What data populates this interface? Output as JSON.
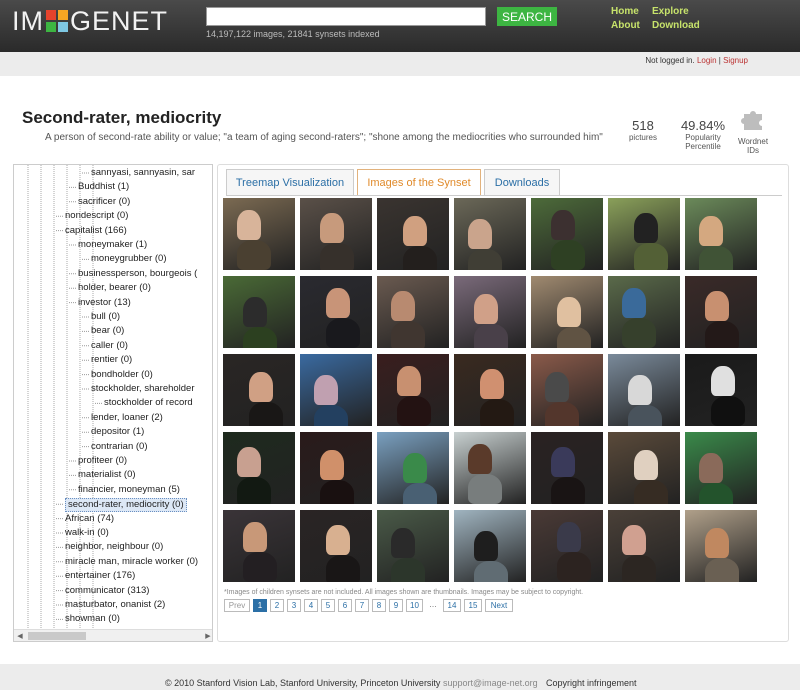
{
  "header": {
    "logo": {
      "left": "IM",
      "right": "GENET"
    },
    "search": {
      "value": "",
      "placeholder": ""
    },
    "search_button": "SEARCH",
    "stats": "14,197,122 images, 21841 synsets indexed",
    "nav": {
      "home": "Home",
      "explore": "Explore",
      "about": "About",
      "download": "Download"
    }
  },
  "login": {
    "status": "Not logged in.",
    "login": "Login",
    "sep": "|",
    "signup": "Signup"
  },
  "synset": {
    "title": "Second-rater, mediocrity",
    "gloss": "A person of second-rate ability or value; \"a team of aging second-raters\"; \"shone among the mediocrities who surrounded him\"",
    "pictures": {
      "value": "518",
      "label": "pictures"
    },
    "popularity": {
      "value": "49.84%",
      "label1": "Popularity",
      "label2": "Percentile"
    },
    "wordnet": {
      "label1": "Wordnet",
      "label2": "IDs"
    }
  },
  "tree": [
    {
      "label": "sannyasi, sannyasin, sar",
      "depth": 5
    },
    {
      "label": "Buddhist (1)",
      "depth": 4
    },
    {
      "label": "sacrificer (0)",
      "depth": 4
    },
    {
      "label": "nondescript (0)",
      "depth": 3
    },
    {
      "label": "capitalist (166)",
      "depth": 3
    },
    {
      "label": "moneymaker (1)",
      "depth": 4
    },
    {
      "label": "moneygrubber (0)",
      "depth": 5
    },
    {
      "label": "businessperson, bourgeois (",
      "depth": 4
    },
    {
      "label": "holder, bearer (0)",
      "depth": 4
    },
    {
      "label": "investor (13)",
      "depth": 4
    },
    {
      "label": "bull (0)",
      "depth": 5
    },
    {
      "label": "bear (0)",
      "depth": 5
    },
    {
      "label": "caller (0)",
      "depth": 5
    },
    {
      "label": "rentier (0)",
      "depth": 5
    },
    {
      "label": "bondholder (0)",
      "depth": 5
    },
    {
      "label": "stockholder, shareholder",
      "depth": 5
    },
    {
      "label": "stockholder of record",
      "depth": 6
    },
    {
      "label": "lender, loaner (2)",
      "depth": 5
    },
    {
      "label": "depositor (1)",
      "depth": 5
    },
    {
      "label": "contrarian (0)",
      "depth": 5
    },
    {
      "label": "profiteer (0)",
      "depth": 4
    },
    {
      "label": "materialist (0)",
      "depth": 4
    },
    {
      "label": "financier, moneyman (5)",
      "depth": 4
    },
    {
      "label": "second-rater, mediocrity (0)",
      "depth": 3,
      "selected": true
    },
    {
      "label": "African (74)",
      "depth": 3
    },
    {
      "label": "walk-in (0)",
      "depth": 3
    },
    {
      "label": "neighbor, neighbour (0)",
      "depth": 3
    },
    {
      "label": "miracle man, miracle worker (0)",
      "depth": 3
    },
    {
      "label": "entertainer (176)",
      "depth": 3
    },
    {
      "label": "communicator (313)",
      "depth": 3
    },
    {
      "label": "masturbator, onanist (2)",
      "depth": 3
    },
    {
      "label": "showman (0)",
      "depth": 3
    }
  ],
  "tabs": [
    "Treemap Visualization",
    "Images of the Synset",
    "Downloads"
  ],
  "active_tab": 1,
  "images": [
    {
      "bg": "#7b6a52",
      "fg": "#d8b49a"
    },
    {
      "bg": "#5a5048",
      "fg": "#c79a7c"
    },
    {
      "bg": "#3a3430",
      "fg": "#d0a080"
    },
    {
      "bg": "#6b6858",
      "fg": "#caa48c"
    },
    {
      "bg": "#4d6b3a",
      "fg": "#3c3030"
    },
    {
      "bg": "#8aa05a",
      "fg": "#222222"
    },
    {
      "bg": "#6b8a5a",
      "fg": "#d4a880"
    },
    {
      "bg": "#4a6a36",
      "fg": "#2c2c2c"
    },
    {
      "bg": "#2a2a30",
      "fg": "#c89478"
    },
    {
      "bg": "#6a5a50",
      "fg": "#b88a70"
    },
    {
      "bg": "#7a6a7a",
      "fg": "#d0a088"
    },
    {
      "bg": "#a08a70",
      "fg": "#e0c0a0"
    },
    {
      "bg": "#5a6a4a",
      "fg": "#3a6a9a"
    },
    {
      "bg": "#3a2a28",
      "fg": "#c89070"
    },
    {
      "bg": "#2a2624",
      "fg": "#d0a084"
    },
    {
      "bg": "#3a6aa0",
      "fg": "#c0a0b0"
    },
    {
      "bg": "#3a1e1e",
      "fg": "#c89070"
    },
    {
      "bg": "#3a2a20",
      "fg": "#d09070"
    },
    {
      "bg": "#8a5a4a",
      "fg": "#4a4a4a"
    },
    {
      "bg": "#7a8a9a",
      "fg": "#d8d8d8"
    },
    {
      "bg": "#1a1a1a",
      "fg": "#e0e0e0"
    },
    {
      "bg": "#1e2a1e",
      "fg": "#c8a090"
    },
    {
      "bg": "#2a1a1a",
      "fg": "#d0906a"
    },
    {
      "bg": "#7aa0c0",
      "fg": "#3a8a4a"
    },
    {
      "bg": "#c8d0d0",
      "fg": "#5a3a2a"
    },
    {
      "bg": "#2a2222",
      "fg": "#3a3a5a"
    },
    {
      "bg": "#5a4a3a",
      "fg": "#e0d0c0"
    },
    {
      "bg": "#3a8a4a",
      "fg": "#8a6a5a"
    },
    {
      "bg": "#3a3438",
      "fg": "#c89878"
    },
    {
      "bg": "#2a2424",
      "fg": "#d8b090"
    },
    {
      "bg": "#4a5a48",
      "fg": "#2a2a2a"
    },
    {
      "bg": "#a0b4c0",
      "fg": "#1e1e1e"
    },
    {
      "bg": "#4a3a36",
      "fg": "#3a3a4a"
    },
    {
      "bg": "#4a4038",
      "fg": "#d0a090"
    },
    {
      "bg": "#b0a08a",
      "fg": "#c08860"
    }
  ],
  "note": "*Images of children synsets are not included. All images shown are thumbnails. Images may be subject to copyright.",
  "pager": {
    "prev": "Prev",
    "pages": [
      "1",
      "2",
      "3",
      "4",
      "5",
      "6",
      "7",
      "8",
      "9",
      "10"
    ],
    "ellipsis": "…",
    "tail": [
      "14",
      "15"
    ],
    "next": "Next",
    "current": "1"
  },
  "footer": {
    "copyright": "© 2010 Stanford Vision Lab, Stanford University, Princeton University",
    "email": "support@image-net.org",
    "infringement": "Copyright infringement"
  }
}
